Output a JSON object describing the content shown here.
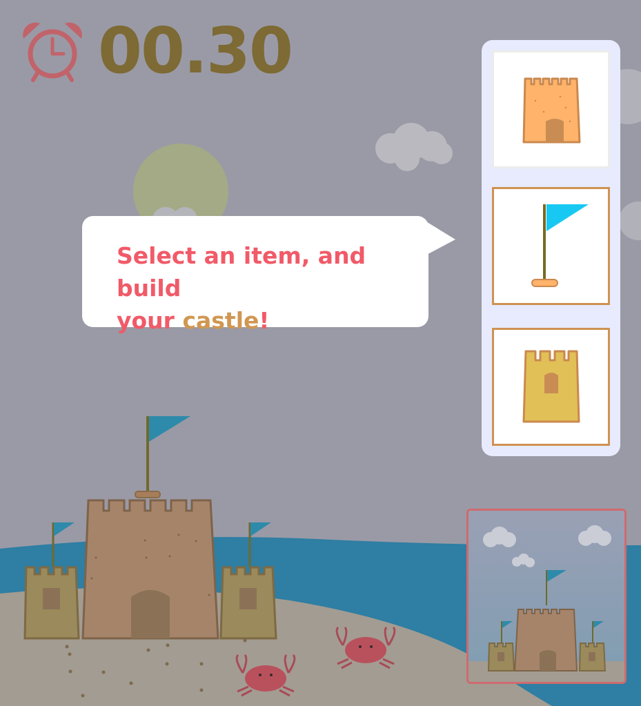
{
  "timer": {
    "value": "00.30",
    "icon": "alarm-clock-icon"
  },
  "tooltip": {
    "line1": "Select an item, and build",
    "line2_a": "your ",
    "line2_b": "castle",
    "line2_c": "!"
  },
  "palette": {
    "items": [
      {
        "name": "castle-tower",
        "icon": "sand-tower-icon",
        "selected": true
      },
      {
        "name": "flag",
        "icon": "flag-icon",
        "selected": false
      },
      {
        "name": "turret",
        "icon": "small-tower-icon",
        "selected": false
      }
    ]
  },
  "preview": {
    "title": ""
  },
  "colors": {
    "overlay": "#9a9aa6",
    "timer": "#7d6a34",
    "accent_pink": "#f15a68",
    "accent_sand": "#d09752",
    "palette_bg": "#e7ebfd"
  }
}
